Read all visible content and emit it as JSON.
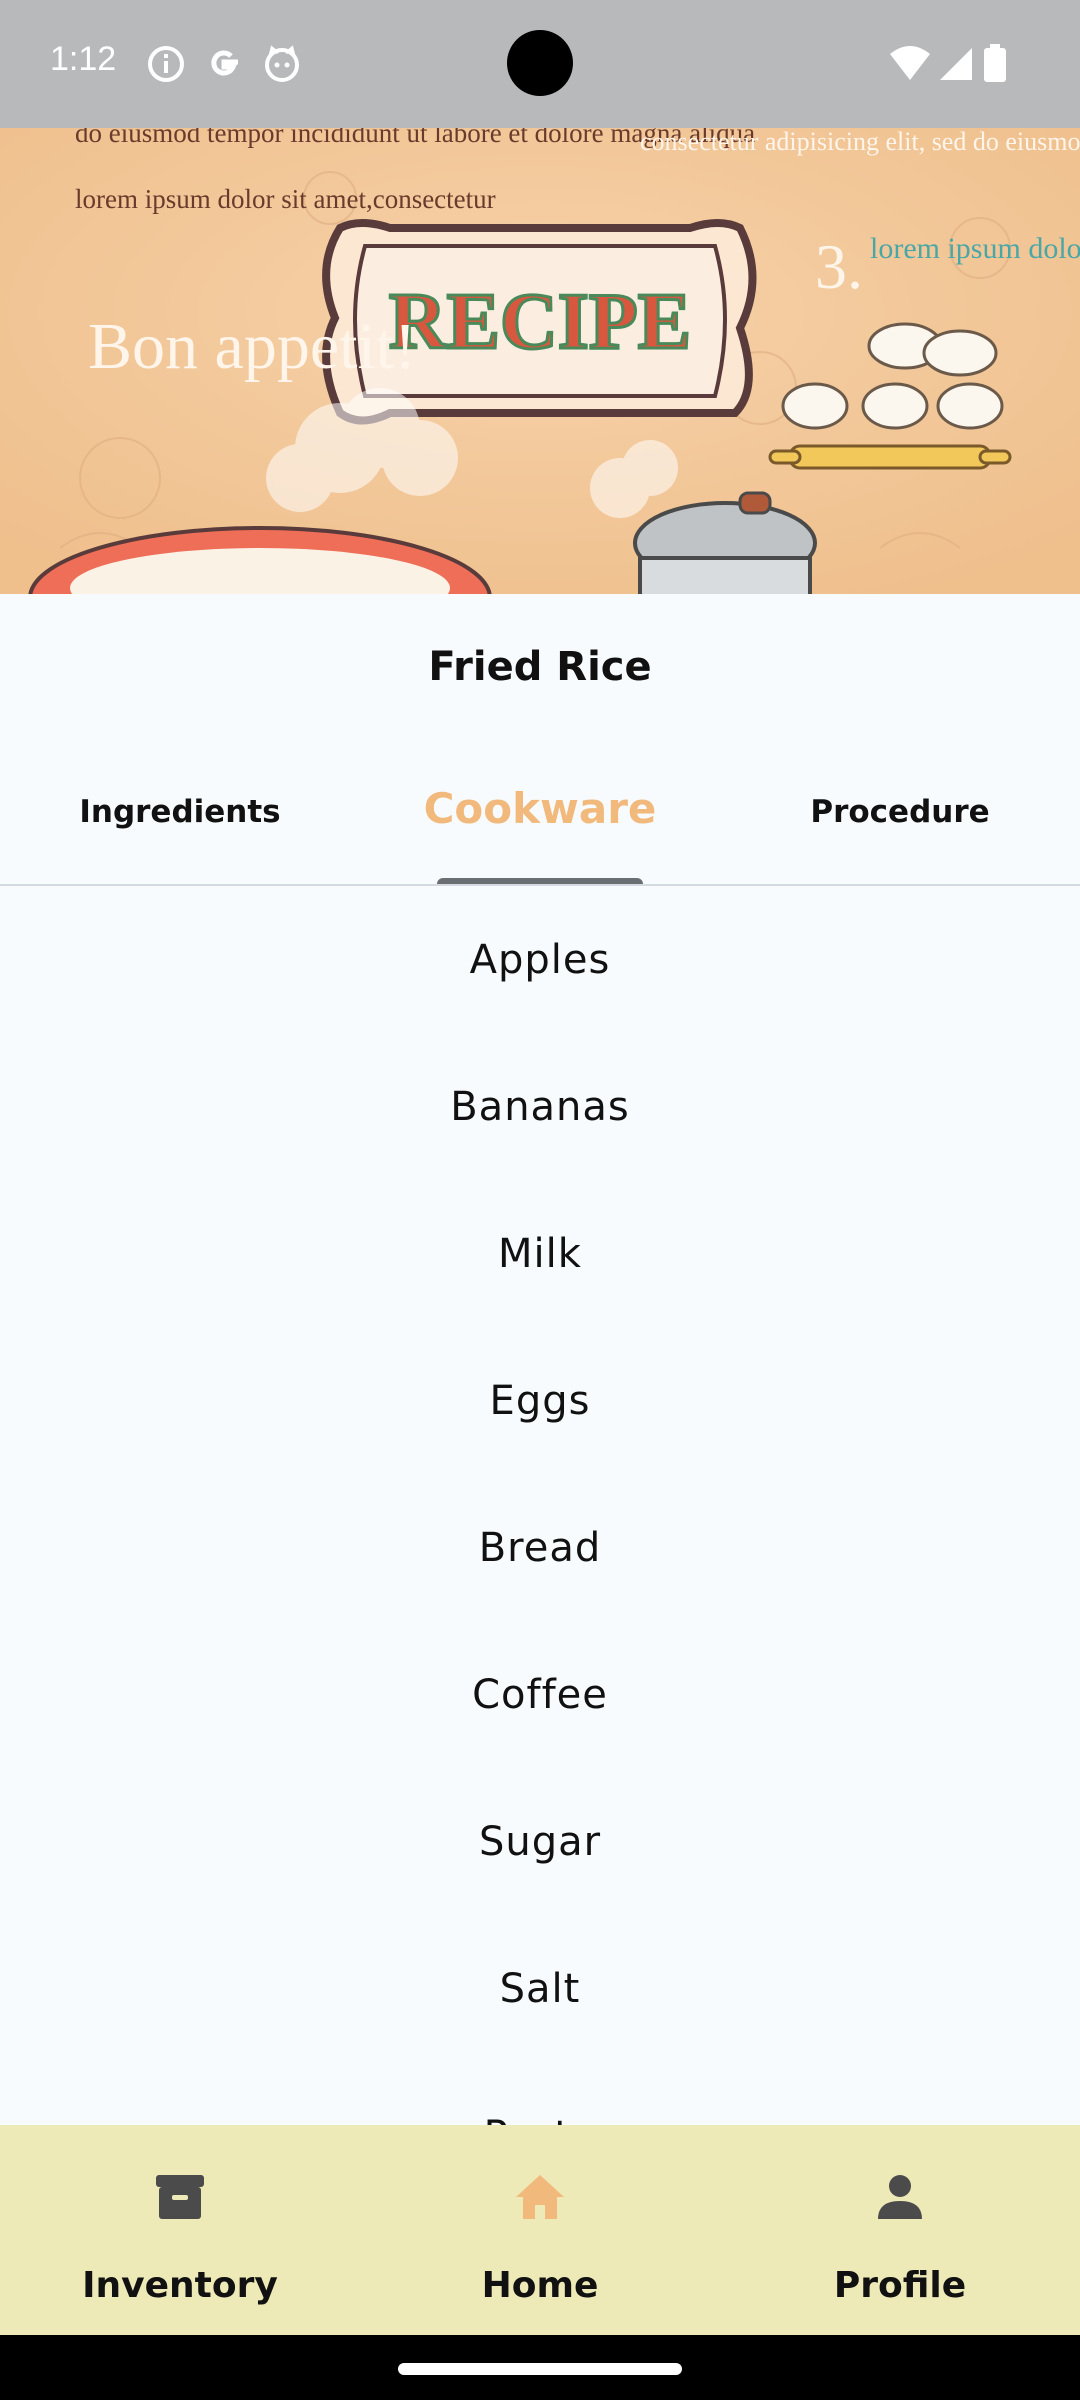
{
  "status_bar": {
    "time": "1:12",
    "icons_left": [
      "info-icon",
      "google-icon",
      "cat-icon"
    ],
    "icons_right": [
      "wifi-icon",
      "signal-icon",
      "battery-icon"
    ]
  },
  "header": {
    "banner_title": "RECIPE",
    "text_top_left": "do eiusmod tempor incididunt ut labore et dolore magna aliqua",
    "text_left_2": "lorem ipsum dolor sit amet,consectetur",
    "bon_appetit": "Bon appetit!",
    "text_top_right": "consectetur adipisicing elit, sed do eiusmod",
    "step_number": "3.",
    "step_text": "lorem ipsum dolor sit"
  },
  "recipe": {
    "title": "Fried Rice"
  },
  "tabs": [
    {
      "label": "Ingredients",
      "selected": false
    },
    {
      "label": "Cookware",
      "selected": true
    },
    {
      "label": "Procedure",
      "selected": false
    }
  ],
  "items": [
    "Apples",
    "Bananas",
    "Milk",
    "Eggs",
    "Bread",
    "Coffee",
    "Sugar",
    "Salt",
    "Pasta"
  ],
  "bottom_nav": [
    {
      "label": "Inventory",
      "icon": "archive-icon",
      "active": false
    },
    {
      "label": "Home",
      "icon": "home-icon",
      "active": true
    },
    {
      "label": "Profile",
      "icon": "person-icon",
      "active": false
    }
  ],
  "colors": {
    "accent": "#f2b97c",
    "content_bg": "#f7fbfd",
    "nav_bg": "#eeeab8",
    "status_bg": "#b7b9bb"
  }
}
